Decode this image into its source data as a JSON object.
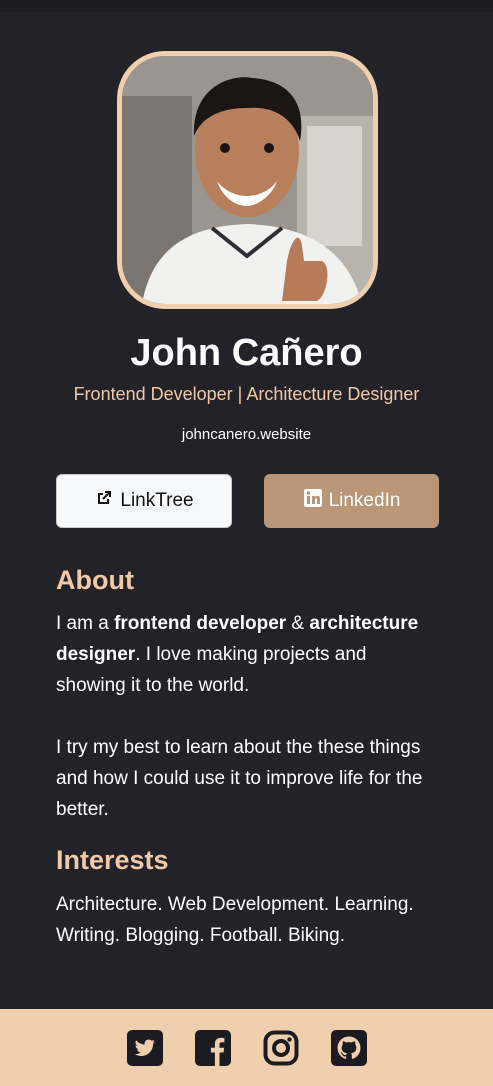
{
  "profile": {
    "name": "John Cañero",
    "role": "Frontend Developer | Architecture Designer",
    "website": "johncanero.website"
  },
  "buttons": {
    "linktree": "LinkTree",
    "linkedin": "LinkedIn"
  },
  "about": {
    "heading": "About",
    "p1_a": "I am a ",
    "p1_b": "frontend developer",
    "p1_c": " & ",
    "p1_d": "architecture designer",
    "p1_e": ". I love making projects and showing it to the world.",
    "p2": "I try my best to learn about the these things and how I could use it to improve life for the better."
  },
  "interests": {
    "heading": "Interests",
    "text": "Architecture. Web Development. Learning. Writing. Blogging. Football. Biking."
  },
  "footer": {
    "icons": [
      "twitter-icon",
      "facebook-icon",
      "instagram-icon",
      "github-icon"
    ]
  },
  "colors": {
    "background": "#232228",
    "accent": "#f0c9a8",
    "linkedin_button": "#b99677",
    "footer": "#f0cfae"
  }
}
